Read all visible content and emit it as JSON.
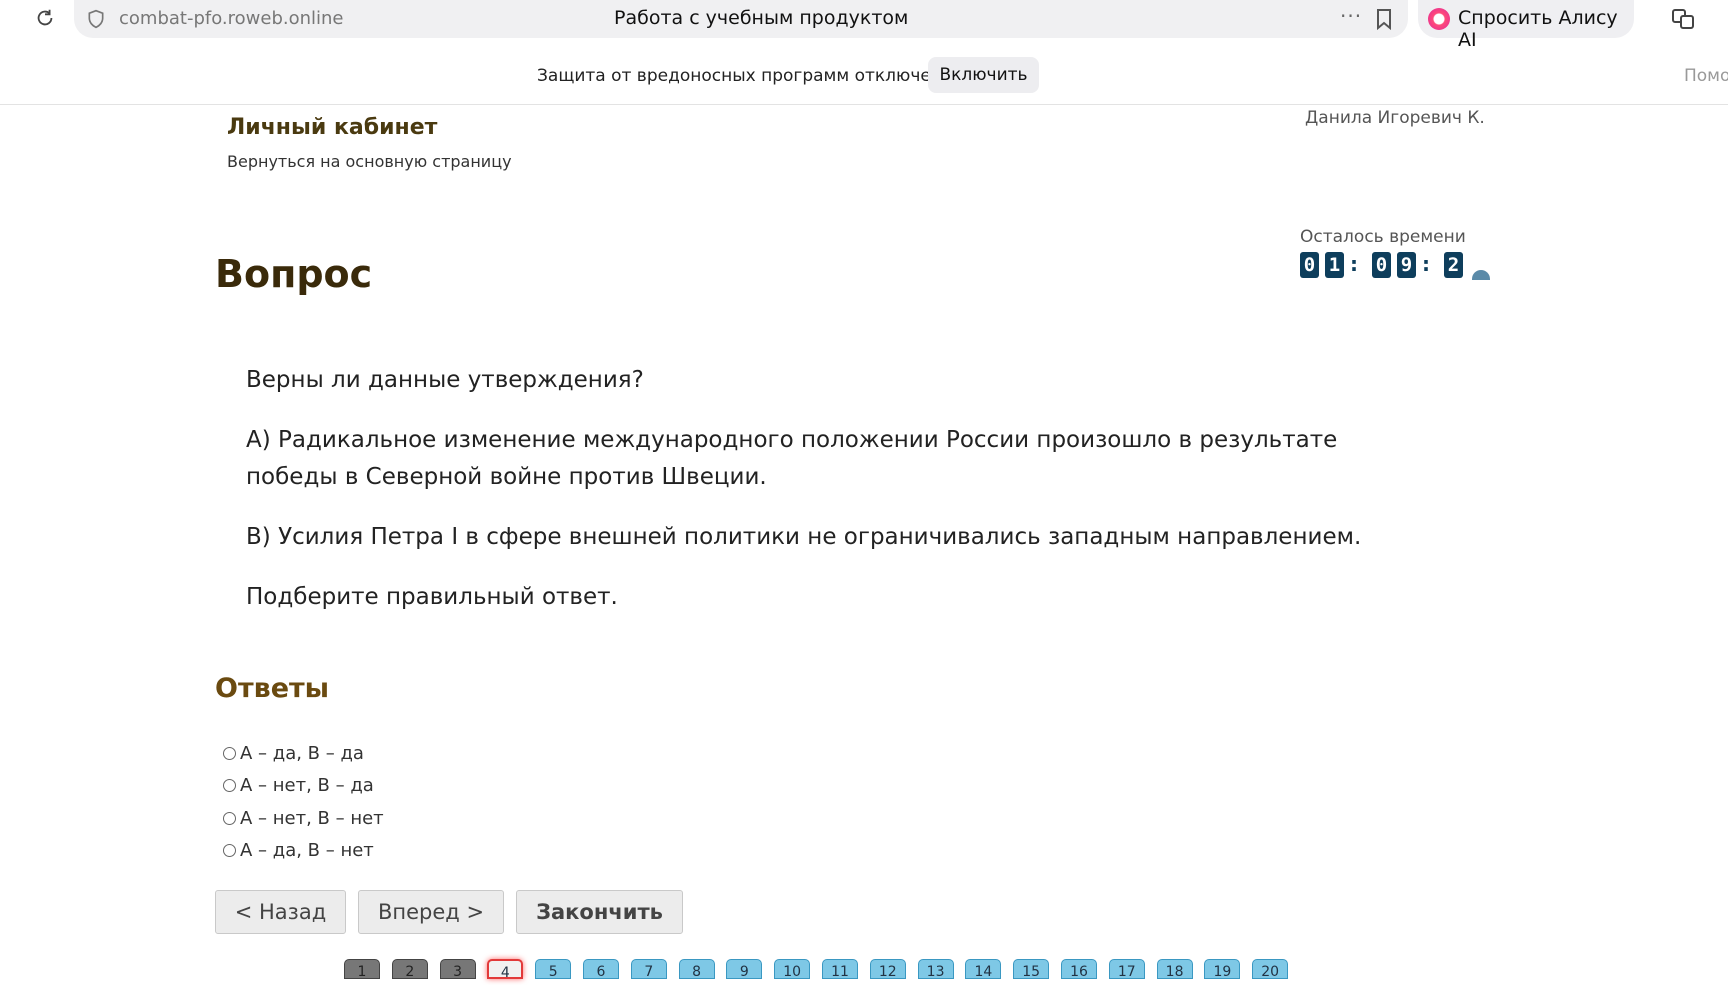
{
  "browser": {
    "url": "combat-pfo.roweb.online",
    "page_title": "Работа с учебным продуктом",
    "menu_dots": "···",
    "alice_label": "Спросить Алису AI"
  },
  "notice": {
    "text": "Защита от вредоносных программ отключена",
    "enable_label": "Включить",
    "help_label": "Помощь"
  },
  "header": {
    "cabinet_title": "Личный кабинет",
    "back_link": "Вернуться на основную страницу",
    "user_name": "Данила Игоревич К."
  },
  "timer": {
    "label": "Осталось времени",
    "digits": [
      "0",
      "1",
      "0",
      "9",
      "2"
    ],
    "separator": ":"
  },
  "question": {
    "title": "Вопрос",
    "paragraphs": [
      "Верны ли данные утверждения?",
      "А) Радикальное изменение международного положении России произошло в результате победы в Северной войне против Швеции.",
      "В) Усилия Петра I в сфере внешней политики не ограничивались западным направлением.",
      "Подберите правильный ответ."
    ]
  },
  "answers": {
    "title": "Ответы",
    "options": [
      "А – да, В – да",
      "А – нет, В – да",
      "А – нет, В – нет",
      "А – да, В – нет"
    ]
  },
  "navigation": {
    "back_label": "< Назад",
    "forward_label": "Вперед >",
    "finish_label": "Закончить"
  },
  "pager": {
    "pages": [
      "1",
      "2",
      "3",
      "4",
      "5",
      "6",
      "7",
      "8",
      "9",
      "10",
      "11",
      "12",
      "13",
      "14",
      "15",
      "16",
      "17",
      "18",
      "19",
      "20"
    ],
    "answered_count": 3,
    "current_page": 4
  },
  "colors": {
    "timer_digit_bg": "#0e3e5c",
    "pager_pending": "#7ec8e6",
    "pager_done": "#777777",
    "pager_current_border": "#e23a3a"
  }
}
